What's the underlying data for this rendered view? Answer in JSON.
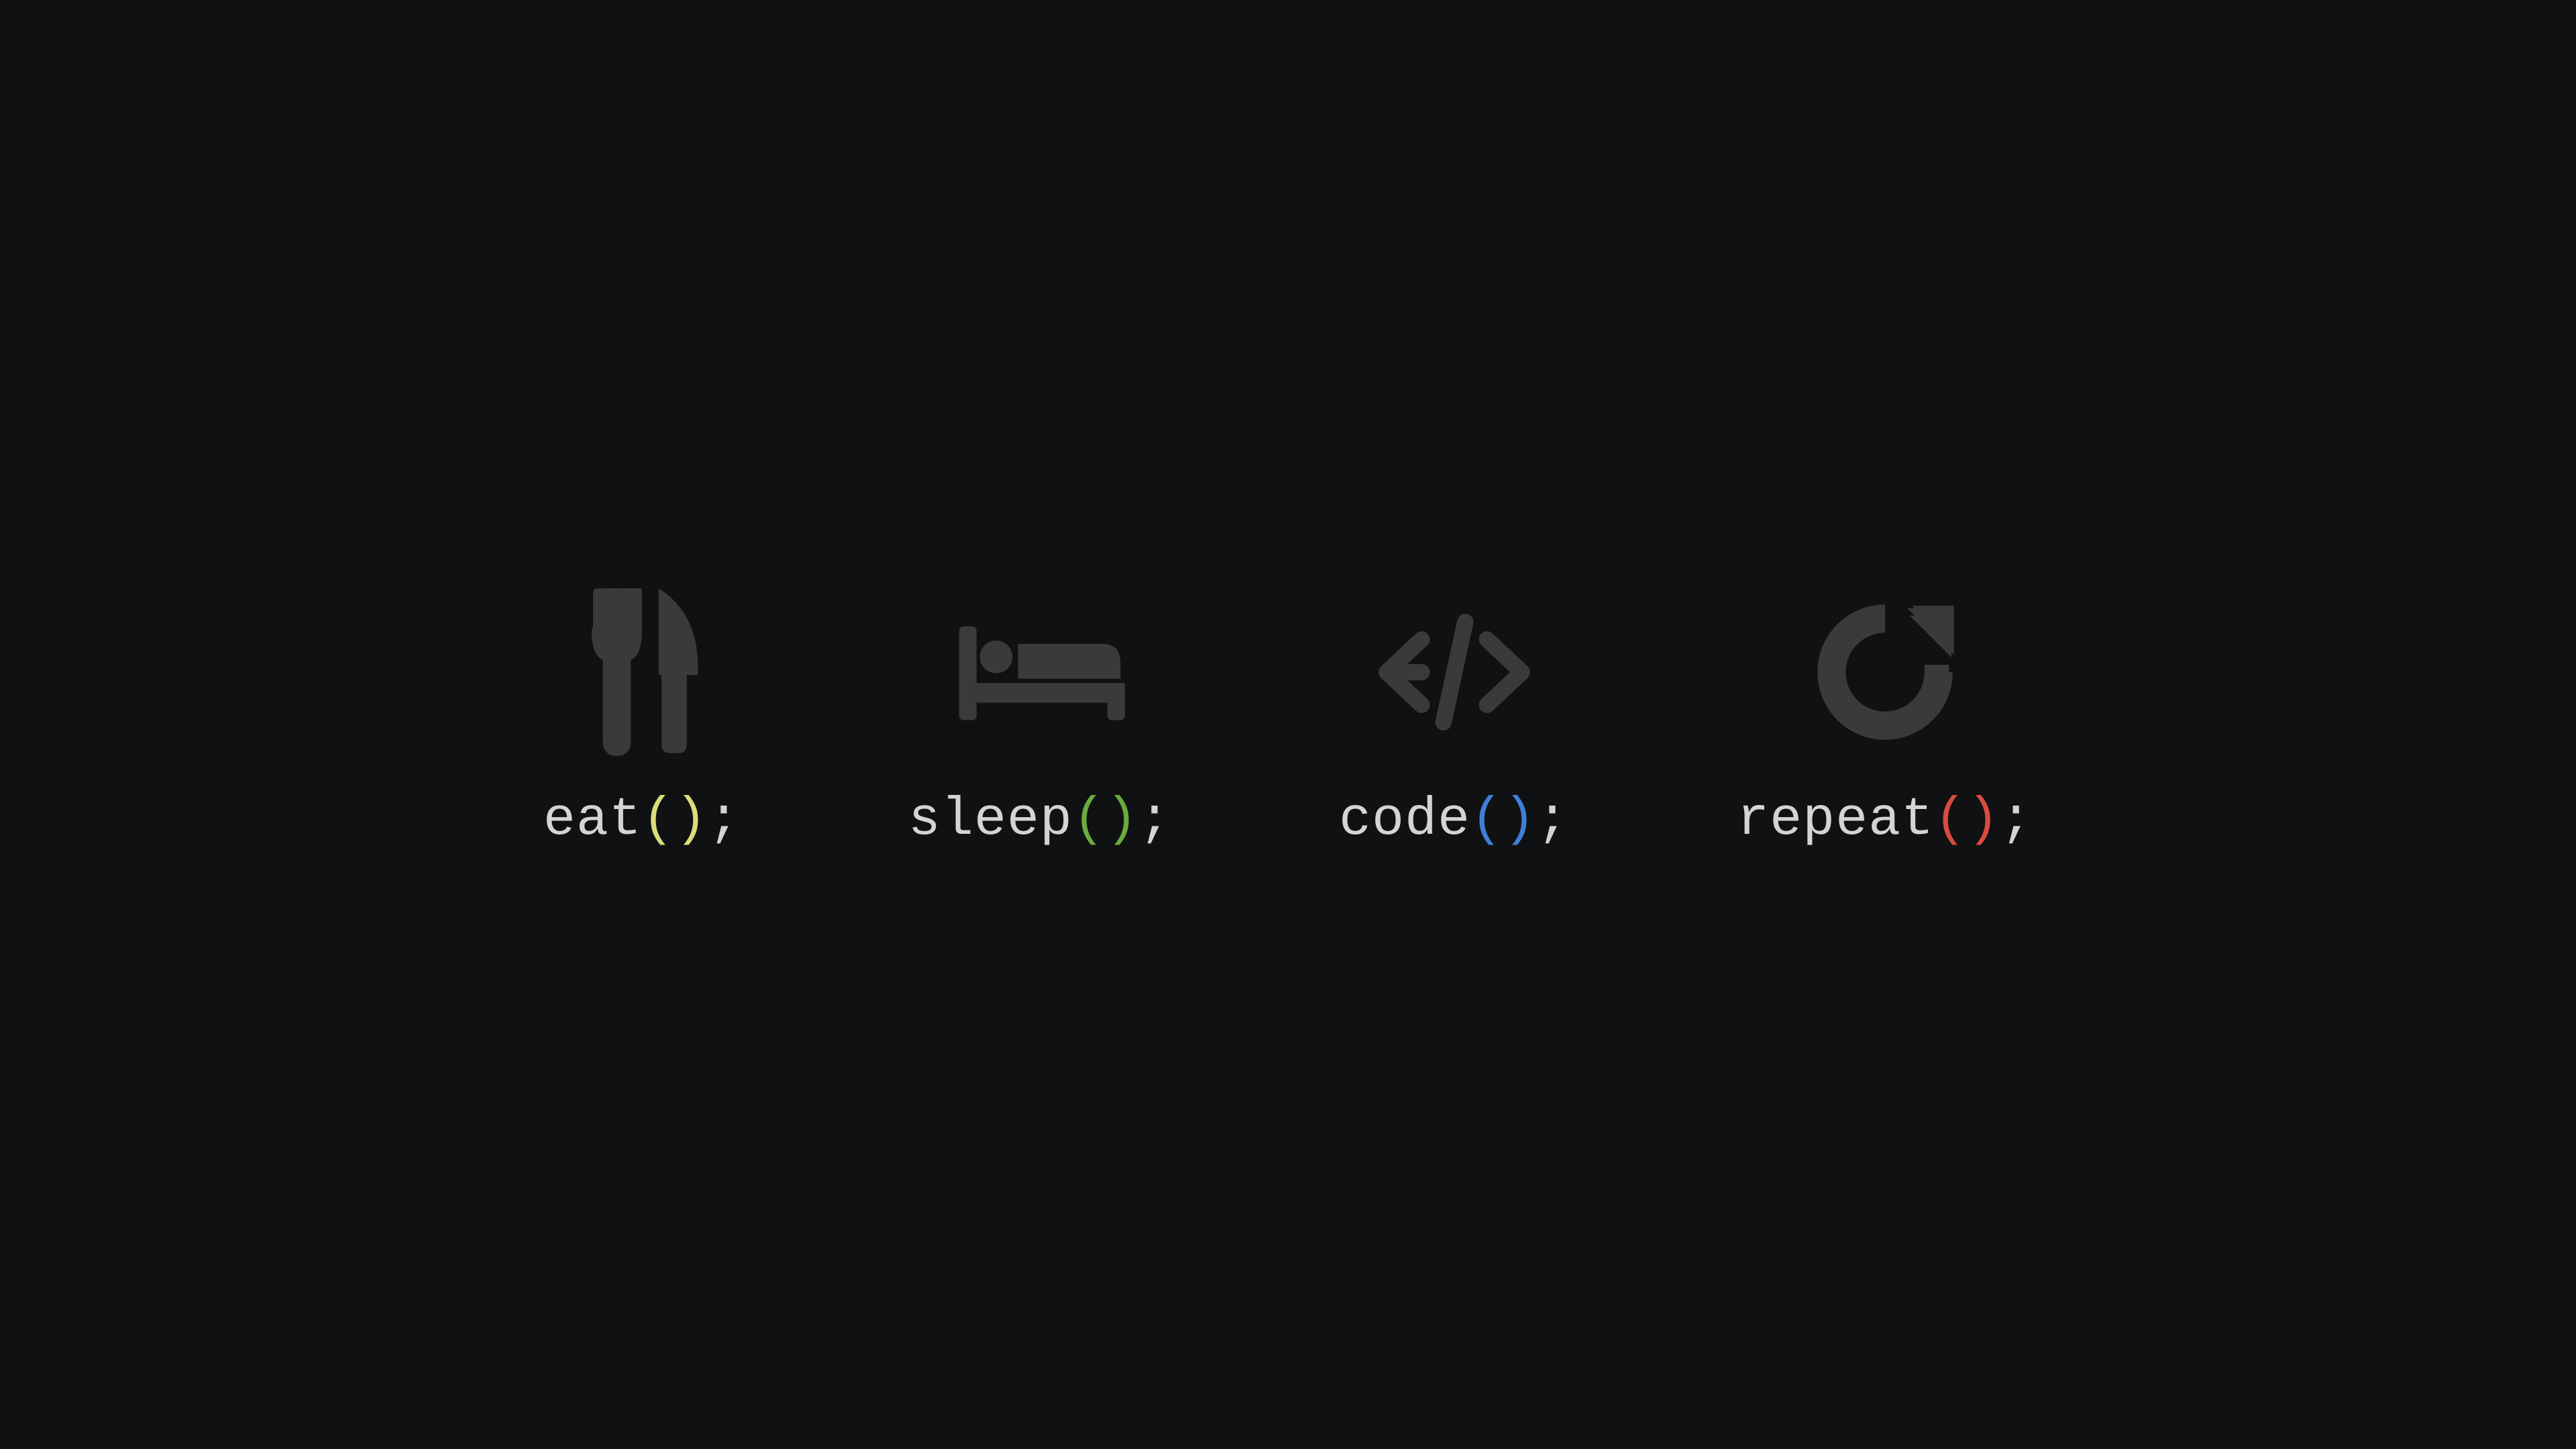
{
  "items": [
    {
      "name": "eat",
      "parens": "()",
      "semi": ";",
      "paren_color": "#dcdc7a",
      "icon": "food"
    },
    {
      "name": "sleep",
      "parens": "()",
      "semi": ";",
      "paren_color": "#6aab3c",
      "icon": "bed"
    },
    {
      "name": "code",
      "parens": "()",
      "semi": ";",
      "paren_color": "#3f7fd8",
      "icon": "code"
    },
    {
      "name": "repeat",
      "parens": "()",
      "semi": ";",
      "paren_color": "#d94b3f",
      "icon": "refresh"
    }
  ],
  "colors": {
    "background": "#101113",
    "icon": "#3a3a3a",
    "text": "#d4d4d4"
  }
}
